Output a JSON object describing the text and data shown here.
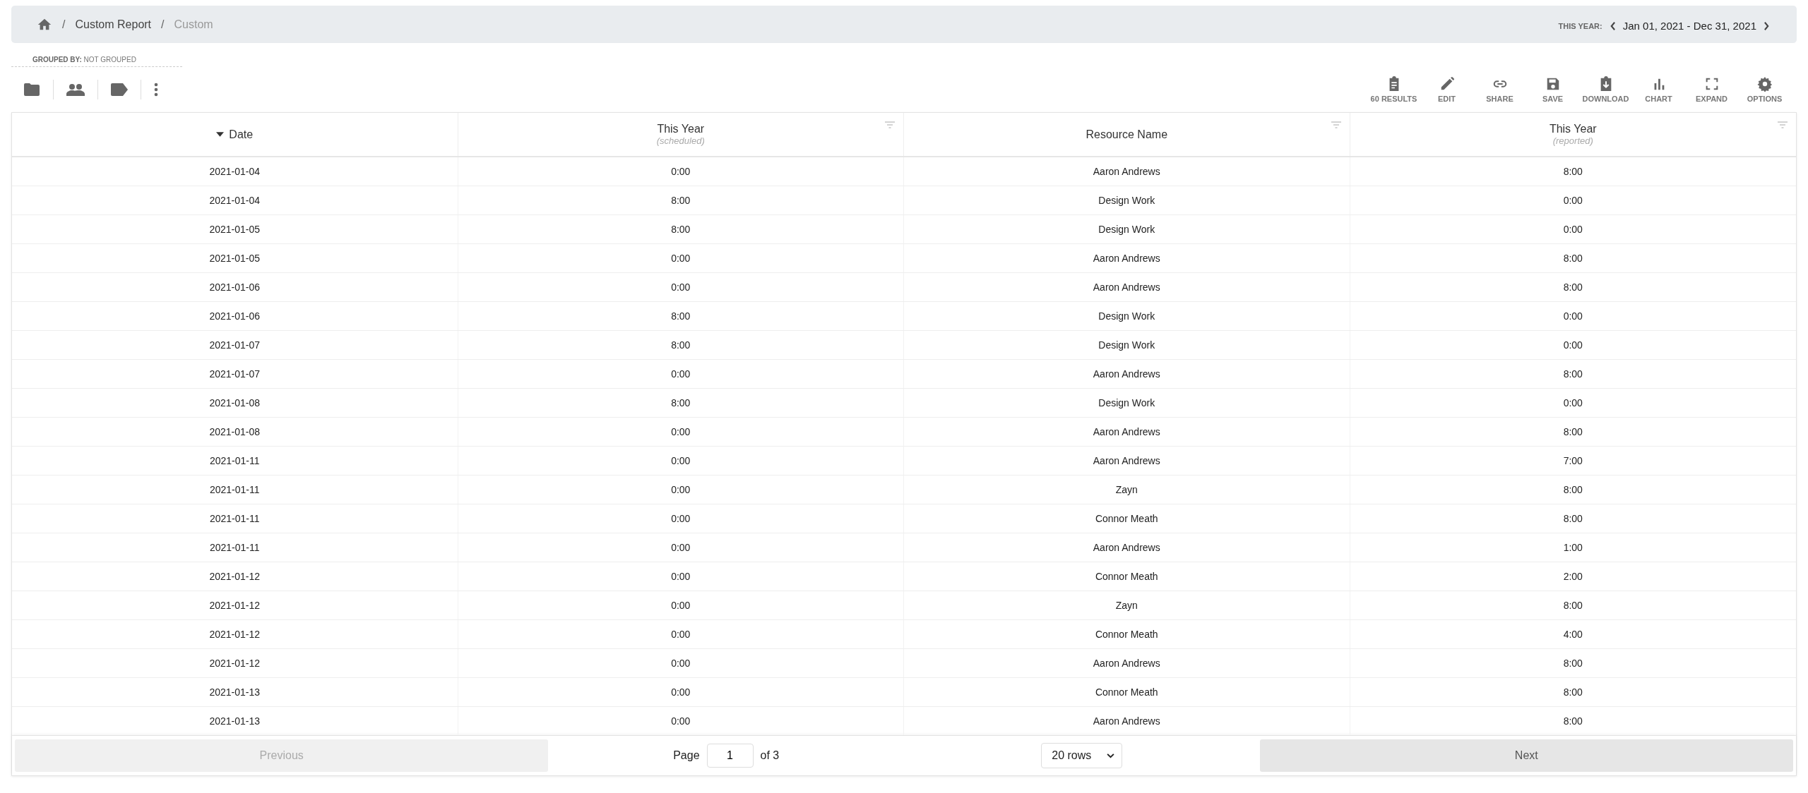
{
  "breadcrumb": {
    "items": [
      {
        "label": "Custom Report",
        "current": false
      },
      {
        "label": "Custom",
        "current": true
      }
    ],
    "separator": "/"
  },
  "date_range": {
    "label": "THIS YEAR:",
    "value": "Jan 01, 2021 - Dec 31, 2021"
  },
  "grouping": {
    "label": "GROUPED BY:",
    "value": "NOT GROUPED"
  },
  "left_tools": [
    {
      "kind": "folder"
    },
    {
      "kind": "people"
    },
    {
      "kind": "tag"
    },
    {
      "kind": "more"
    }
  ],
  "toolbar": [
    {
      "kind": "results",
      "label": "60 RESULTS"
    },
    {
      "kind": "edit",
      "label": "EDIT"
    },
    {
      "kind": "share",
      "label": "SHARE"
    },
    {
      "kind": "save",
      "label": "SAVE"
    },
    {
      "kind": "download",
      "label": "DOWNLOAD"
    },
    {
      "kind": "chart",
      "label": "CHART"
    },
    {
      "kind": "expand",
      "label": "EXPAND"
    },
    {
      "kind": "options",
      "label": "OPTIONS"
    }
  ],
  "table": {
    "columns": [
      {
        "title": "Date",
        "sorted": true,
        "filter": false
      },
      {
        "title": "This Year",
        "subtitle": "(scheduled)",
        "sorted": false,
        "filter": true
      },
      {
        "title": "Resource Name",
        "sorted": false,
        "filter": true
      },
      {
        "title": "This Year",
        "subtitle": "(reported)",
        "sorted": false,
        "filter": true
      }
    ],
    "rows": [
      [
        "2021-01-04",
        "0:00",
        "Aaron Andrews",
        "8:00"
      ],
      [
        "2021-01-04",
        "8:00",
        "Design Work",
        "0:00"
      ],
      [
        "2021-01-05",
        "8:00",
        "Design Work",
        "0:00"
      ],
      [
        "2021-01-05",
        "0:00",
        "Aaron Andrews",
        "8:00"
      ],
      [
        "2021-01-06",
        "0:00",
        "Aaron Andrews",
        "8:00"
      ],
      [
        "2021-01-06",
        "8:00",
        "Design Work",
        "0:00"
      ],
      [
        "2021-01-07",
        "8:00",
        "Design Work",
        "0:00"
      ],
      [
        "2021-01-07",
        "0:00",
        "Aaron Andrews",
        "8:00"
      ],
      [
        "2021-01-08",
        "8:00",
        "Design Work",
        "0:00"
      ],
      [
        "2021-01-08",
        "0:00",
        "Aaron Andrews",
        "8:00"
      ],
      [
        "2021-01-11",
        "0:00",
        "Aaron Andrews",
        "7:00"
      ],
      [
        "2021-01-11",
        "0:00",
        "Zayn",
        "8:00"
      ],
      [
        "2021-01-11",
        "0:00",
        "Connor Meath",
        "8:00"
      ],
      [
        "2021-01-11",
        "0:00",
        "Aaron Andrews",
        "1:00"
      ],
      [
        "2021-01-12",
        "0:00",
        "Connor Meath",
        "2:00"
      ],
      [
        "2021-01-12",
        "0:00",
        "Zayn",
        "8:00"
      ],
      [
        "2021-01-12",
        "0:00",
        "Connor Meath",
        "4:00"
      ],
      [
        "2021-01-12",
        "0:00",
        "Aaron Andrews",
        "8:00"
      ],
      [
        "2021-01-13",
        "0:00",
        "Connor Meath",
        "8:00"
      ],
      [
        "2021-01-13",
        "0:00",
        "Aaron Andrews",
        "8:00"
      ]
    ]
  },
  "pagination": {
    "previous": {
      "label": "Previous",
      "disabled": true
    },
    "page_label": "Page",
    "page": "1",
    "of_label": "of 3",
    "rows_select": "20 rows",
    "next": {
      "label": "Next",
      "disabled": false
    }
  }
}
